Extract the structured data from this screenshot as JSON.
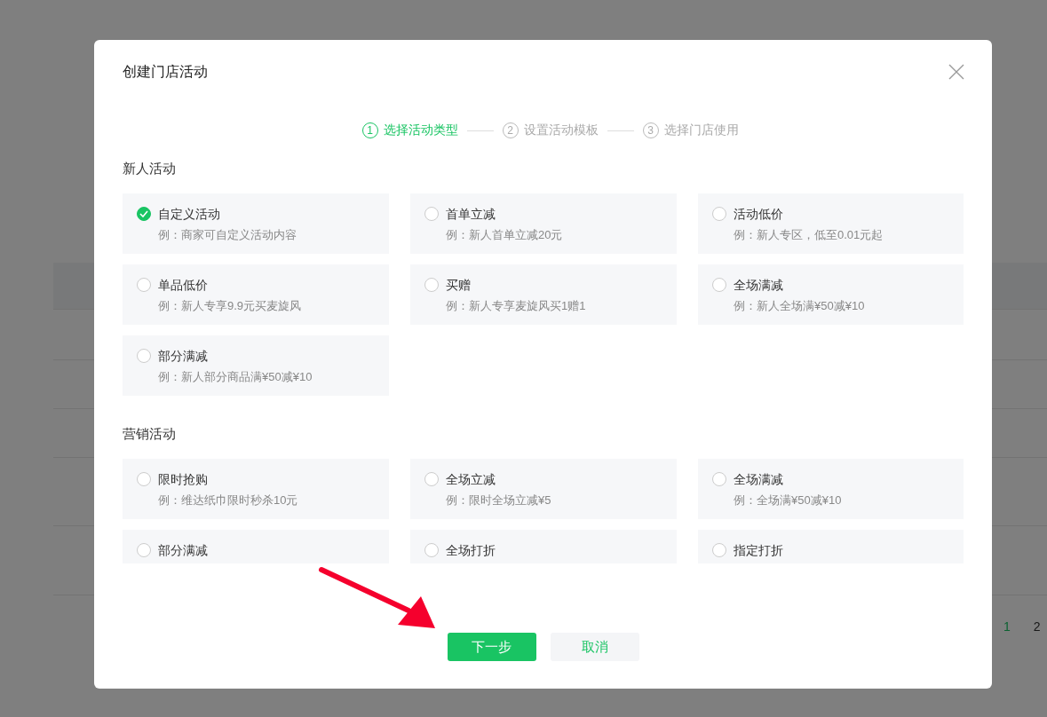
{
  "page": {
    "pagination": [
      {
        "label": "1",
        "selected": true
      },
      {
        "label": "2",
        "selected": false
      }
    ]
  },
  "dialog": {
    "title": "创建门店活动",
    "steps": [
      {
        "number": "1",
        "label": "选择活动类型",
        "selected": true
      },
      {
        "number": "2",
        "label": "设置活动模板",
        "selected": false
      },
      {
        "number": "3",
        "label": "选择门店使用",
        "selected": false
      }
    ],
    "sections": [
      {
        "title": "新人活动",
        "options": [
          {
            "title": "自定义活动",
            "example": "例：商家可自定义活动内容",
            "selected": true
          },
          {
            "title": "首单立减",
            "example": "例：新人首单立减20元",
            "selected": false
          },
          {
            "title": "活动低价",
            "example": "例：新人专区，低至0.01元起",
            "selected": false
          },
          {
            "title": "单品低价",
            "example": "例：新人专享9.9元买麦旋风",
            "selected": false
          },
          {
            "title": "买赠",
            "example": "例：新人专享麦旋风买1赠1",
            "selected": false
          },
          {
            "title": "全场满减",
            "example": "例：新人全场满¥50减¥10",
            "selected": false
          },
          {
            "title": "部分满减",
            "example": "例：新人部分商品满¥50减¥10",
            "selected": false
          }
        ]
      },
      {
        "title": "营销活动",
        "options": [
          {
            "title": "限时抢购",
            "example": "例：维达纸巾限时秒杀10元",
            "selected": false
          },
          {
            "title": "全场立减",
            "example": "例：限时全场立减¥5",
            "selected": false
          },
          {
            "title": "全场满减",
            "example": "例：全场满¥50减¥10",
            "selected": false
          },
          {
            "title": "部分满减",
            "selected": false
          },
          {
            "title": "全场打折",
            "selected": false
          },
          {
            "title": "指定打折",
            "selected": false
          }
        ]
      }
    ],
    "buttons": [
      {
        "label": "下一步",
        "kind": "primary"
      },
      {
        "label": "取消",
        "kind": "secondary"
      }
    ]
  }
}
